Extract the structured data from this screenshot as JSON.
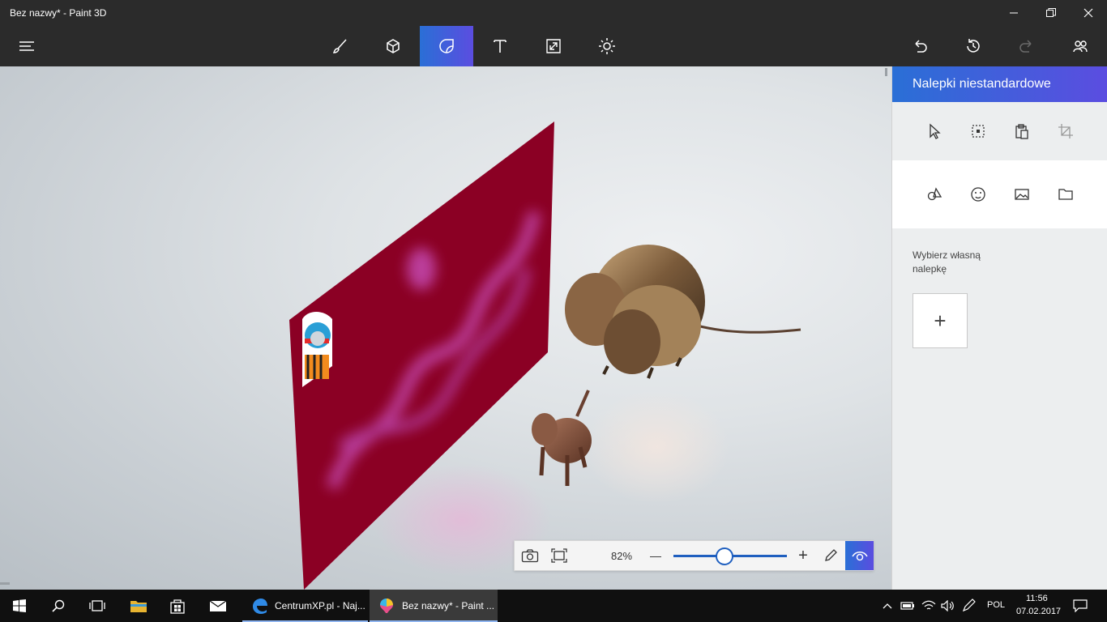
{
  "window": {
    "title": "Bez nazwy* - Paint 3D",
    "controls": [
      "minimize-icon",
      "restore-icon",
      "close-icon"
    ]
  },
  "toolbar": {
    "left": "menu-icon",
    "tools": [
      {
        "name": "brush-icon",
        "active": false
      },
      {
        "name": "cube-3d-icon",
        "active": false
      },
      {
        "name": "stickers-icon",
        "active": true
      },
      {
        "name": "text-icon",
        "active": false
      },
      {
        "name": "canvas-resize-icon",
        "active": false
      },
      {
        "name": "effects-sun-icon",
        "active": false
      }
    ],
    "right": [
      "undo-icon",
      "history-icon",
      "redo-icon",
      "community-icon"
    ],
    "accent": "#3b62d9"
  },
  "panel": {
    "title": "Nalepki niestandardowe",
    "row1": [
      "select-pointer-icon",
      "marquee-select-icon",
      "paste-icon",
      "crop-icon"
    ],
    "row2": [
      "shapes-icon",
      "sticker-emoji-icon",
      "picture-icon",
      "folder-icon"
    ],
    "caption": "Wybierz własną nalepkę",
    "add_label": "+"
  },
  "zoom": {
    "value": "82%",
    "minus": "—",
    "plus": "+",
    "level": 0.45
  },
  "taskbar": {
    "apps": [
      {
        "label": "CentrumXP.pl - Naj...",
        "icon": "edge-icon"
      },
      {
        "label": "Bez nazwy* - Paint ...",
        "icon": "paint3d-icon",
        "active": true
      }
    ],
    "language": "POL",
    "time": "11:56",
    "date": "07.02.2017"
  },
  "colors": {
    "wall": "#8b0024",
    "chrome": "#2b2b2b",
    "taskbar": "#101010"
  }
}
